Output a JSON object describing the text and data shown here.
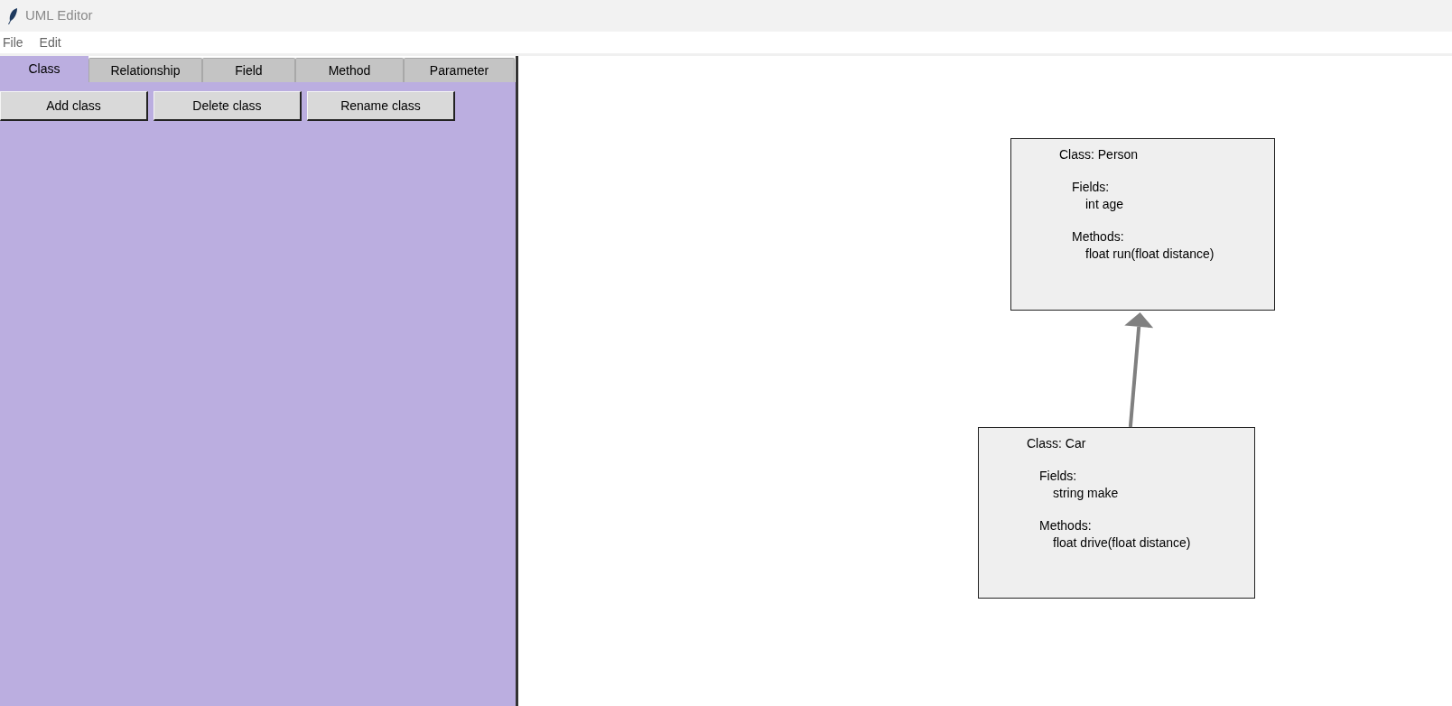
{
  "window": {
    "title": "UML Editor"
  },
  "menu": [
    "File",
    "Edit"
  ],
  "tabs": [
    {
      "label": "Class",
      "selected": true
    },
    {
      "label": "Relationship",
      "selected": false
    },
    {
      "label": "Field",
      "selected": false
    },
    {
      "label": "Method",
      "selected": false
    },
    {
      "label": "Parameter",
      "selected": false
    }
  ],
  "buttons": [
    "Add class",
    "Delete class",
    "Rename class"
  ],
  "classes": [
    {
      "title": "Class: Person",
      "fields_label": "Fields:",
      "fields": [
        "int age"
      ],
      "methods_label": "Methods:",
      "methods": [
        "float run(float distance)"
      ]
    },
    {
      "title": "Class: Car",
      "fields_label": "Fields:",
      "fields": [
        "string make"
      ],
      "methods_label": "Methods:",
      "methods": [
        "float drive(float distance)"
      ]
    }
  ],
  "relationships": [
    {
      "kind": "inheritance"
    }
  ]
}
